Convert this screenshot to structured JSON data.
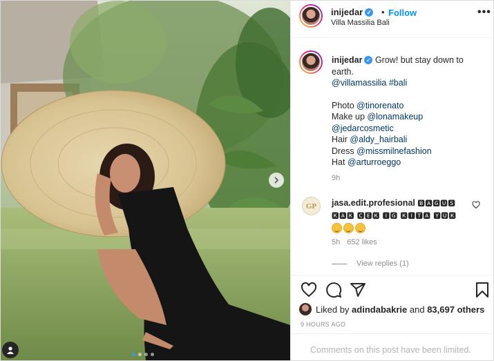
{
  "header": {
    "username": "inijedar",
    "verified": true,
    "separator": "•",
    "follow_label": "Follow",
    "location": "Villa Massilia Bali",
    "more_label": "•••"
  },
  "caption": {
    "username": "inijedar",
    "line1": "Grow! but stay down to earth.",
    "tags": [
      "@villamassilia",
      "#bali"
    ],
    "credits": [
      {
        "label": "Photo ",
        "handle": "@tinorenato"
      },
      {
        "label": "Make up ",
        "handle": "@lonamakeup"
      },
      {
        "label": "",
        "handle": "@jedarcosmetic"
      },
      {
        "label": "Hair ",
        "handle": "@aldy_hairbali"
      },
      {
        "label": "Dress ",
        "handle": "@missmilnefashion"
      },
      {
        "label": "Hat ",
        "handle": "@arturroeggo"
      }
    ],
    "time": "9h"
  },
  "comment": {
    "avatar_text": "GP",
    "username": "jasa.edit.profesional",
    "text": "🅱🅰🅶🆄🆂 🅺🅰🅺 🅲🅴🅺 🅸🅶 🅺🅸🆃🅰 🆈🆄🅺",
    "emojis": [
      "smile-emoji",
      "blush-emoji",
      "kiss-emoji"
    ],
    "time": "5h",
    "likes": "652 likes",
    "view_replies": "View replies (1)"
  },
  "actions": {
    "icons": [
      "heart-icon",
      "comment-icon",
      "share-icon",
      "bookmark-icon"
    ]
  },
  "likes": {
    "prefix": "Liked by",
    "user": "adindabakrie",
    "middle": "and",
    "others": "83,697 others"
  },
  "post_time": "9 HOURS AGO",
  "comments_limited": "Comments on this post have been limited.",
  "carousel": {
    "count": 4,
    "active": 0
  },
  "colors": {
    "accent": "#0095f6",
    "link": "#00376b",
    "muted": "#8e8e8e"
  }
}
